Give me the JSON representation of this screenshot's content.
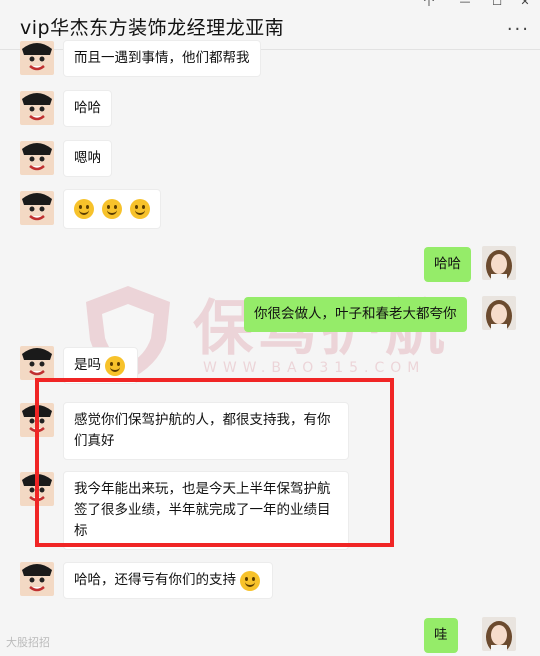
{
  "window": {
    "title": "vip华杰东方装饰龙经理龙亚南",
    "more_label": "...",
    "min_label": "—",
    "max_label": "☐",
    "pin_label": "个"
  },
  "messages": [
    {
      "side": "left",
      "text": "而且一遇到事情，他们都帮我"
    },
    {
      "side": "left",
      "text": "哈哈"
    },
    {
      "side": "left",
      "text": "嗯呐"
    },
    {
      "side": "left",
      "text": "",
      "emoji": [
        "smile-emoji",
        "smile-emoji",
        "smile-emoji"
      ]
    },
    {
      "side": "right",
      "text": "哈哈"
    },
    {
      "side": "right",
      "text": "你很会做人，叶子和春老大都夸你"
    },
    {
      "side": "left",
      "text": "是吗"
    },
    {
      "side": "left",
      "text": "感觉你们保驾护航的人，都很支持我，有你们真好"
    },
    {
      "side": "left",
      "text": "我今年能出来玩，也是今天上半年保驾护航签了很多业绩，半年就完成了一年的业绩目标"
    },
    {
      "side": "left",
      "text": "哈哈，还得亏有你们的支持"
    },
    {
      "side": "right",
      "text": "哇"
    }
  ],
  "watermark": {
    "text": "保驾护航",
    "url": "WWW.BAO315.COM"
  },
  "footer": {
    "text": "大股招招"
  },
  "colors": {
    "right_bubble": "#95ec69",
    "left_bubble": "#ffffff",
    "highlight_box": "#f02525"
  }
}
